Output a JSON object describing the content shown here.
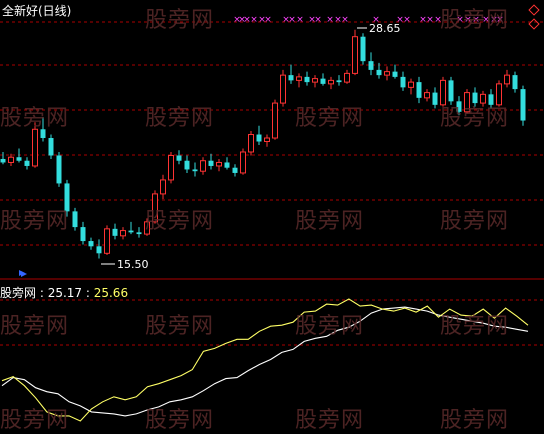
{
  "title": "全新好(日线)",
  "watermark": "股旁网",
  "indicator": {
    "name": "股旁网",
    "value1": "25.17",
    "value2": "25.66"
  },
  "annotations": {
    "high": "28.65",
    "low": "15.50"
  },
  "colors": {
    "up": "#ff3333",
    "down": "#33dddd",
    "grid": "#aa0000",
    "marker": "#ff44ff",
    "line_white": "#ffffff",
    "line_yellow": "#ffff66"
  },
  "chart_data": [
    {
      "type": "candlestick",
      "title": "全新好(日线)",
      "ylim": [
        14.5,
        29.5
      ],
      "candles": [
        {
          "o": 21.2,
          "h": 21.6,
          "l": 20.9,
          "c": 21.0
        },
        {
          "o": 21.0,
          "h": 21.5,
          "l": 20.8,
          "c": 21.3
        },
        {
          "o": 21.3,
          "h": 21.8,
          "l": 21.0,
          "c": 21.1
        },
        {
          "o": 21.1,
          "h": 21.3,
          "l": 20.6,
          "c": 20.8
        },
        {
          "o": 20.8,
          "h": 23.3,
          "l": 20.7,
          "c": 22.9
        },
        {
          "o": 22.9,
          "h": 23.6,
          "l": 22.2,
          "c": 22.4
        },
        {
          "o": 22.4,
          "h": 22.6,
          "l": 21.2,
          "c": 21.4
        },
        {
          "o": 21.4,
          "h": 21.6,
          "l": 19.6,
          "c": 19.8
        },
        {
          "o": 19.8,
          "h": 20.0,
          "l": 17.9,
          "c": 18.2
        },
        {
          "o": 18.2,
          "h": 18.4,
          "l": 17.1,
          "c": 17.3
        },
        {
          "o": 17.3,
          "h": 17.6,
          "l": 16.3,
          "c": 16.5
        },
        {
          "o": 16.5,
          "h": 16.7,
          "l": 16.0,
          "c": 16.2
        },
        {
          "o": 16.2,
          "h": 16.6,
          "l": 15.5,
          "c": 15.8
        },
        {
          "o": 15.8,
          "h": 17.4,
          "l": 15.7,
          "c": 17.2
        },
        {
          "o": 17.2,
          "h": 17.5,
          "l": 16.6,
          "c": 16.8
        },
        {
          "o": 16.8,
          "h": 17.3,
          "l": 16.6,
          "c": 17.1
        },
        {
          "o": 17.1,
          "h": 17.6,
          "l": 16.9,
          "c": 17.0
        },
        {
          "o": 17.0,
          "h": 17.3,
          "l": 16.7,
          "c": 16.9
        },
        {
          "o": 16.9,
          "h": 17.8,
          "l": 16.8,
          "c": 17.6
        },
        {
          "o": 17.6,
          "h": 19.4,
          "l": 17.5,
          "c": 19.2
        },
        {
          "o": 19.2,
          "h": 20.3,
          "l": 18.9,
          "c": 20.0
        },
        {
          "o": 20.0,
          "h": 21.6,
          "l": 19.8,
          "c": 21.4
        },
        {
          "o": 21.4,
          "h": 21.7,
          "l": 20.9,
          "c": 21.1
        },
        {
          "o": 21.1,
          "h": 21.4,
          "l": 20.4,
          "c": 20.6
        },
        {
          "o": 20.6,
          "h": 21.0,
          "l": 20.2,
          "c": 20.5
        },
        {
          "o": 20.5,
          "h": 21.3,
          "l": 20.3,
          "c": 21.1
        },
        {
          "o": 21.1,
          "h": 21.5,
          "l": 20.6,
          "c": 20.8
        },
        {
          "o": 20.8,
          "h": 21.2,
          "l": 20.5,
          "c": 21.0
        },
        {
          "o": 21.0,
          "h": 21.3,
          "l": 20.6,
          "c": 20.7
        },
        {
          "o": 20.7,
          "h": 20.9,
          "l": 20.2,
          "c": 20.4
        },
        {
          "o": 20.4,
          "h": 21.8,
          "l": 20.3,
          "c": 21.6
        },
        {
          "o": 21.6,
          "h": 22.8,
          "l": 21.4,
          "c": 22.6
        },
        {
          "o": 22.6,
          "h": 23.1,
          "l": 22.0,
          "c": 22.2
        },
        {
          "o": 22.2,
          "h": 22.6,
          "l": 21.9,
          "c": 22.4
        },
        {
          "o": 22.4,
          "h": 24.6,
          "l": 22.3,
          "c": 24.4
        },
        {
          "o": 24.4,
          "h": 26.3,
          "l": 24.2,
          "c": 26.0
        },
        {
          "o": 26.0,
          "h": 26.6,
          "l": 25.5,
          "c": 25.7
        },
        {
          "o": 25.7,
          "h": 26.1,
          "l": 25.3,
          "c": 25.9
        },
        {
          "o": 25.9,
          "h": 26.2,
          "l": 25.4,
          "c": 25.6
        },
        {
          "o": 25.6,
          "h": 26.0,
          "l": 25.3,
          "c": 25.8
        },
        {
          "o": 25.8,
          "h": 26.1,
          "l": 25.4,
          "c": 25.5
        },
        {
          "o": 25.5,
          "h": 25.9,
          "l": 25.2,
          "c": 25.7
        },
        {
          "o": 25.7,
          "h": 26.0,
          "l": 25.4,
          "c": 25.6
        },
        {
          "o": 25.6,
          "h": 26.3,
          "l": 25.5,
          "c": 26.1
        },
        {
          "o": 26.1,
          "h": 28.6,
          "l": 26.0,
          "c": 28.2
        },
        {
          "o": 28.2,
          "h": 28.4,
          "l": 26.6,
          "c": 26.8
        },
        {
          "o": 26.8,
          "h": 27.3,
          "l": 26.0,
          "c": 26.3
        },
        {
          "o": 26.3,
          "h": 26.7,
          "l": 25.8,
          "c": 26.0
        },
        {
          "o": 26.0,
          "h": 26.5,
          "l": 25.7,
          "c": 26.2
        },
        {
          "o": 26.2,
          "h": 26.6,
          "l": 25.8,
          "c": 25.9
        },
        {
          "o": 25.9,
          "h": 26.2,
          "l": 25.1,
          "c": 25.3
        },
        {
          "o": 25.3,
          "h": 25.8,
          "l": 24.9,
          "c": 25.6
        },
        {
          "o": 25.6,
          "h": 25.9,
          "l": 24.4,
          "c": 24.7
        },
        {
          "o": 24.7,
          "h": 25.2,
          "l": 24.5,
          "c": 25.0
        },
        {
          "o": 25.0,
          "h": 25.3,
          "l": 24.1,
          "c": 24.3
        },
        {
          "o": 24.3,
          "h": 25.9,
          "l": 24.2,
          "c": 25.7
        },
        {
          "o": 25.7,
          "h": 25.9,
          "l": 24.3,
          "c": 24.5
        },
        {
          "o": 24.5,
          "h": 24.8,
          "l": 23.7,
          "c": 23.9
        },
        {
          "o": 23.9,
          "h": 25.2,
          "l": 23.8,
          "c": 25.0
        },
        {
          "o": 25.0,
          "h": 25.3,
          "l": 24.2,
          "c": 24.4
        },
        {
          "o": 24.4,
          "h": 25.1,
          "l": 24.2,
          "c": 24.9
        },
        {
          "o": 24.9,
          "h": 25.2,
          "l": 24.1,
          "c": 24.3
        },
        {
          "o": 24.3,
          "h": 25.7,
          "l": 24.2,
          "c": 25.5
        },
        {
          "o": 25.5,
          "h": 26.3,
          "l": 25.3,
          "c": 26.0
        },
        {
          "o": 26.0,
          "h": 26.2,
          "l": 25.0,
          "c": 25.2
        },
        {
          "o": 25.2,
          "h": 25.4,
          "l": 23.1,
          "c": 23.4
        }
      ]
    },
    {
      "type": "line",
      "series": [
        {
          "values": [
            17.0,
            17.8,
            17.6,
            16.8,
            16.4,
            16.2,
            15.4,
            15.0,
            14.4,
            14.3,
            14.2,
            14.0,
            14.2,
            14.6,
            14.9,
            15.4,
            15.6,
            15.9,
            16.5,
            17.2,
            17.7,
            17.8,
            18.5,
            19.1,
            19.6,
            20.3,
            20.6,
            21.4,
            21.7,
            21.9,
            22.5,
            22.8,
            23.4,
            24.2,
            24.6,
            24.7,
            24.8,
            24.6,
            24.4,
            24.0,
            23.8,
            23.6,
            23.4,
            23.2,
            22.9,
            22.8,
            22.6,
            22.4
          ]
        },
        {
          "values": [
            17.5,
            17.9,
            17.0,
            15.8,
            14.4,
            14.0,
            14.0,
            13.5,
            14.7,
            15.4,
            15.9,
            15.6,
            15.9,
            16.9,
            17.2,
            17.6,
            18.0,
            18.6,
            20.4,
            20.7,
            21.2,
            21.6,
            21.6,
            22.4,
            22.9,
            23.0,
            23.3,
            24.3,
            24.4,
            25.1,
            25.0,
            25.6,
            24.9,
            25.0,
            24.6,
            24.4,
            24.7,
            24.3,
            24.9,
            23.8,
            24.6,
            24.0,
            23.9,
            24.6,
            23.7,
            24.7,
            23.9,
            23.0
          ]
        }
      ]
    }
  ]
}
